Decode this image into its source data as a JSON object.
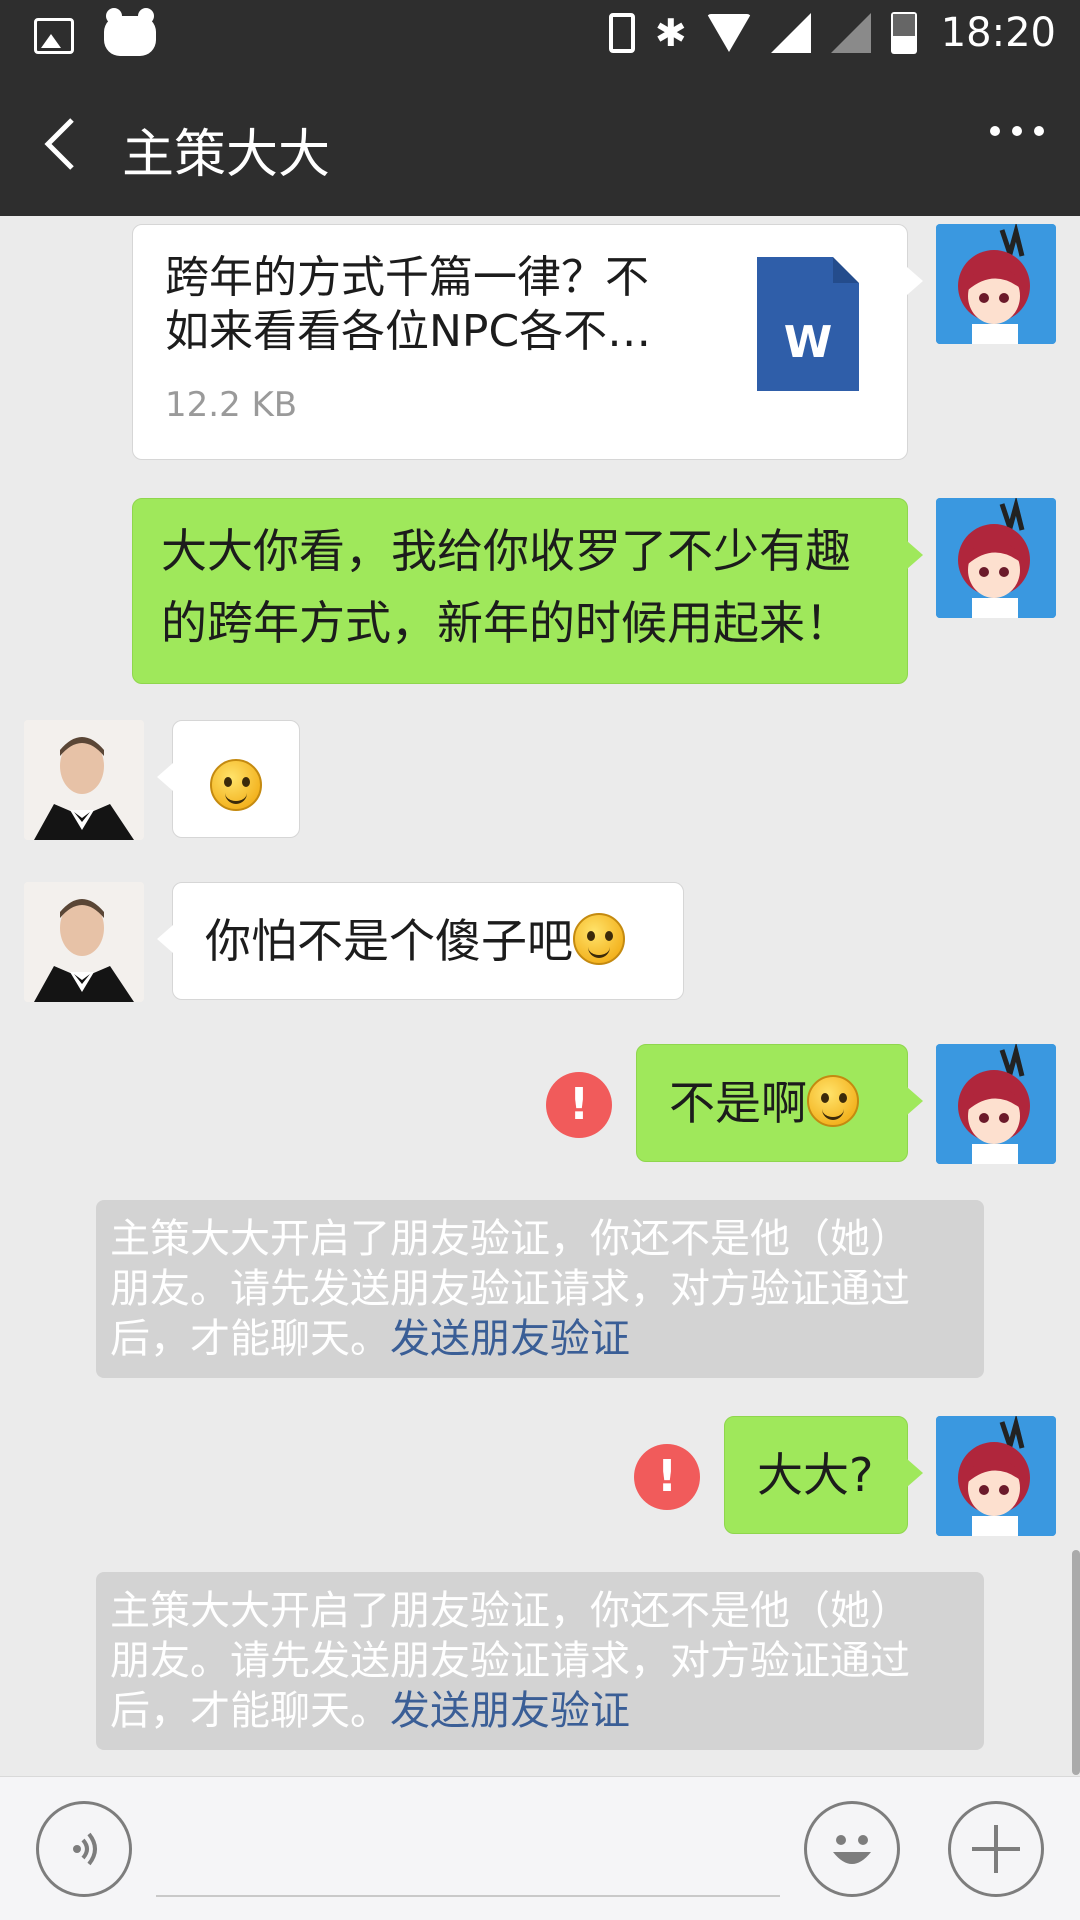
{
  "status_bar": {
    "time": "18:20"
  },
  "title_bar": {
    "title": "主策大大"
  },
  "messages": {
    "file": {
      "name_line1": "跨年的方式千篇一律？不",
      "name_line2": "如来看看各位NPC各不…",
      "size": "12.2 KB",
      "type_letter": "W"
    },
    "sent_text": {
      "line1": "大大你看，我给你收罗了不少有趣",
      "line2": "的跨年方式，新年的时候用起来！"
    },
    "reply_1": {
      "emoji": "smile-emoji"
    },
    "reply_2": {
      "text": "你怕不是个傻子吧"
    },
    "sent_2": {
      "text": "不是啊",
      "error_mark": "!"
    },
    "notice_1": {
      "line1": "主策大大开启了朋友验证，你还不是他（她）",
      "line2": "朋友。请先发送朋友验证请求，对方验证通过",
      "line3": "后，才能聊天。",
      "link": "发送朋友验证"
    },
    "sent_3": {
      "text": "大大?",
      "error_mark": "!"
    },
    "notice_2": {
      "line1": "主策大大开启了朋友验证，你还不是他（她）",
      "line2": "朋友。请先发送朋友验证请求，对方验证通过",
      "line3": "后，才能聊天。",
      "link": "发送朋友验证"
    }
  },
  "colors": {
    "bubble_green": "#9fe85b",
    "error_red": "#f15b5b",
    "link_blue": "#3a5e96",
    "header_dark": "#2e2e2e"
  },
  "input_bar": {
    "voice_icon": "voice-icon",
    "emoji_icon": "emoji-icon",
    "plus_icon": "plus-icon"
  }
}
